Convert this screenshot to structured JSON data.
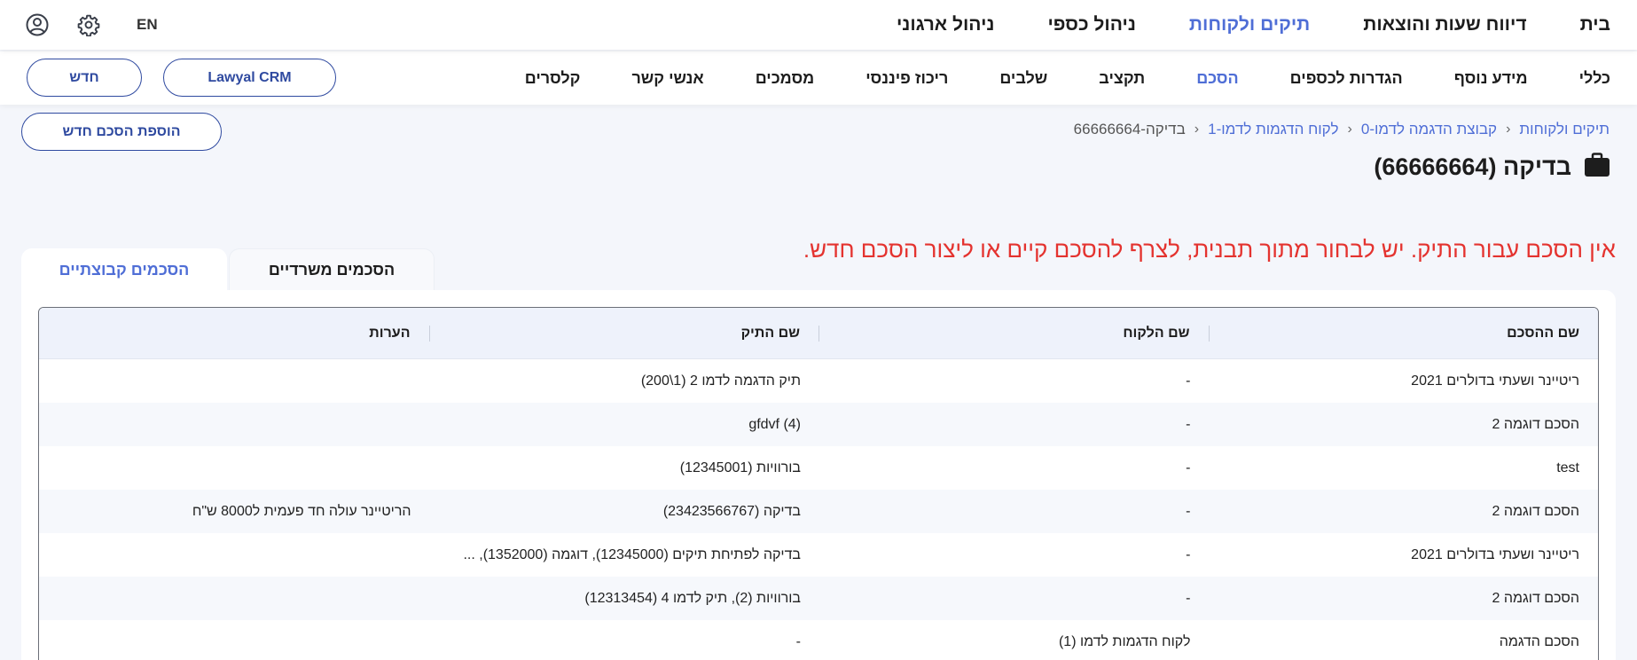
{
  "top_nav": {
    "items": [
      {
        "label": "בית",
        "active": false
      },
      {
        "label": "דיווח שעות והוצאות",
        "active": false
      },
      {
        "label": "תיקים ולקוחות",
        "active": true
      },
      {
        "label": "ניהול כספי",
        "active": false
      },
      {
        "label": "ניהול ארגוני",
        "active": false
      }
    ],
    "lang_label": "EN",
    "icons": [
      "user-circle-icon",
      "gear-icon"
    ]
  },
  "sub_nav": {
    "items": [
      {
        "label": "כללי",
        "active": false
      },
      {
        "label": "מידע נוסף",
        "active": false
      },
      {
        "label": "הגדרות לכספים",
        "active": false
      },
      {
        "label": "הסכם",
        "active": true
      },
      {
        "label": "תקציב",
        "active": false
      },
      {
        "label": "שלבים",
        "active": false
      },
      {
        "label": "ריכוז פיננסי",
        "active": false
      },
      {
        "label": "מסמכים",
        "active": false
      },
      {
        "label": "אנשי קשר",
        "active": false
      },
      {
        "label": "קלסרים",
        "active": false
      }
    ],
    "crm_button": "Lawyal CRM",
    "new_button": "חדש"
  },
  "breadcrumb": [
    "תיקים ולקוחות",
    "קבוצת הדגמה לדמו-0",
    "לקוח הדגמות לדמו-1",
    "בדיקה-66666664"
  ],
  "page_title": "בדיקה (66666664)",
  "add_agreement_button": "הוספת הסכם חדש",
  "warning_text": "אין הסכם עבור התיק. יש לבחור מתוך תבנית, לצרף להסכם קיים או ליצור הסכם חדש.",
  "tabs": {
    "office": "הסכמים משרדיים",
    "group": "הסכמים קבוצתיים"
  },
  "table": {
    "headers": [
      "שם ההסכם",
      "שם הלקוח",
      "שם התיק",
      "הערות"
    ],
    "rows": [
      [
        "ריטיינר ושעתי בדולרים 2021",
        "-",
        "תיק הדגמה לדמו 2 (1\\200)",
        ""
      ],
      [
        "הסכם דוגמה 2",
        "-",
        "gfdvf (4)",
        ""
      ],
      [
        "test",
        "-",
        "בורוויות (12345001)",
        ""
      ],
      [
        "הסכם דוגמה 2",
        "-",
        "בדיקה (23423566767)",
        "הריטיינר עולה חד פעמית ל8000 ש\"ח"
      ],
      [
        "ריטיינר ושעתי בדולרים 2021",
        "-",
        "בדיקה לפתיחת תיקים (12345000), דוגמה (1352000), ...",
        ""
      ],
      [
        "הסכם דוגמה 2",
        "-",
        "בורוויות (2), תיק לדמו 4 (12313454)",
        ""
      ],
      [
        "הסכם הדגמה",
        "לקוח הדגמות לדמו (1)",
        "-",
        ""
      ]
    ]
  },
  "colors": {
    "accent": "#4f6ed6",
    "button_border": "#2f4aa0",
    "warning": "#e4332f"
  }
}
